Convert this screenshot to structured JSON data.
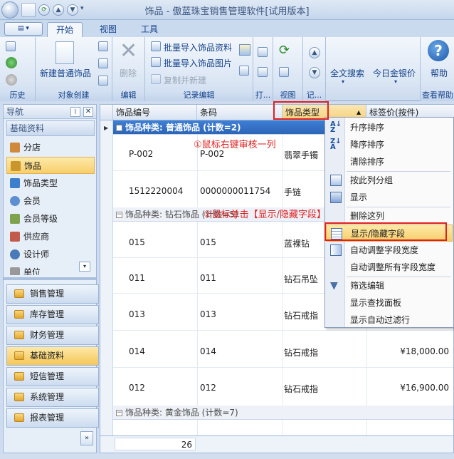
{
  "window": {
    "title": "饰品 - 傲蓝珠宝销售管理软件[试用版本]"
  },
  "qa_icons": [
    "refresh-icon",
    "up-icon",
    "down-icon"
  ],
  "tabs": [
    {
      "label": "开始"
    },
    {
      "label": "视图"
    },
    {
      "label": "工具"
    }
  ],
  "ribbon": {
    "groups": [
      {
        "label": "历史"
      },
      {
        "label": "对象创建"
      },
      {
        "label": "编辑"
      },
      {
        "label": "记录编辑"
      },
      {
        "label": "打..."
      },
      {
        "label": "视图"
      },
      {
        "label": "记..."
      },
      {
        "label": "查看帮助"
      }
    ],
    "new_item": "新建普通饰品",
    "delete": "删除",
    "batch_import_info": "批量导入饰品资料",
    "batch_import_img": "批量导入饰品图片",
    "copy_new": "复制并新建",
    "fulltext_search": "全文搜索",
    "gold_price": "今日金银价",
    "help": "帮助"
  },
  "nav": {
    "header": "导航",
    "section": "基础资料",
    "items": [
      {
        "label": "分店"
      },
      {
        "label": "饰品"
      },
      {
        "label": "饰品类型"
      },
      {
        "label": "会员"
      },
      {
        "label": "会员等级"
      },
      {
        "label": "供应商"
      },
      {
        "label": "设计师"
      },
      {
        "label": "单位"
      }
    ],
    "modules": [
      {
        "label": "销售管理"
      },
      {
        "label": "库存管理"
      },
      {
        "label": "财务管理"
      },
      {
        "label": "基础资料"
      },
      {
        "label": "短信管理"
      },
      {
        "label": "系统管理"
      },
      {
        "label": "报表管理"
      }
    ]
  },
  "grid": {
    "columns": [
      "饰品编号",
      "条码",
      "饰品类型",
      "标签价(按件)"
    ],
    "groups": [
      {
        "label": "饰品种类: 普通饰品 (计数=2)"
      },
      {
        "label": "饰品种类: 钻石饰品 (计数=5)"
      },
      {
        "label": "饰品种类: 黄金饰品 (计数=7)"
      }
    ],
    "rows": [
      {
        "code": "P-002",
        "barcode": "P-002",
        "type": "翡翠手镯",
        "price": ""
      },
      {
        "code": "1512220004",
        "barcode": "0000000011754",
        "type": "手链",
        "price": ""
      },
      {
        "code": "015",
        "barcode": "015",
        "type": "蓝裸钻",
        "price": ""
      },
      {
        "code": "011",
        "barcode": "011",
        "type": "钻石吊坠",
        "price": ""
      },
      {
        "code": "013",
        "barcode": "013",
        "type": "钻石戒指",
        "price": ""
      },
      {
        "code": "014",
        "barcode": "014",
        "type": "钻石戒指",
        "price": "¥18,000.00"
      },
      {
        "code": "012",
        "barcode": "012",
        "type": "钻石戒指",
        "price": "¥16,900.00"
      }
    ],
    "footer_count": "26"
  },
  "context_menu": [
    {
      "label": "升序排序",
      "icon": "sort-asc-icon"
    },
    {
      "label": "降序排序",
      "icon": "sort-desc-icon"
    },
    {
      "label": "清除排序",
      "icon": ""
    },
    {
      "label": "按此列分组",
      "icon": "group-icon"
    },
    {
      "label": "显示",
      "icon": "show-icon"
    },
    {
      "label": "删除这列",
      "icon": ""
    },
    {
      "label": "显示/隐藏字段",
      "icon": "column-chooser-icon"
    },
    {
      "label": "自动调整字段宽度",
      "icon": "autofit-icon"
    },
    {
      "label": "自动调整所有字段宽度",
      "icon": ""
    },
    {
      "label": "筛选编辑",
      "icon": "filter-icon"
    },
    {
      "label": "显示查找面板",
      "icon": ""
    },
    {
      "label": "显示自动过滤行",
      "icon": ""
    }
  ],
  "annotations": {
    "step1": "①鼠标右键审核一列",
    "step2": "②鼠标单击【显示/隐藏字段】"
  }
}
